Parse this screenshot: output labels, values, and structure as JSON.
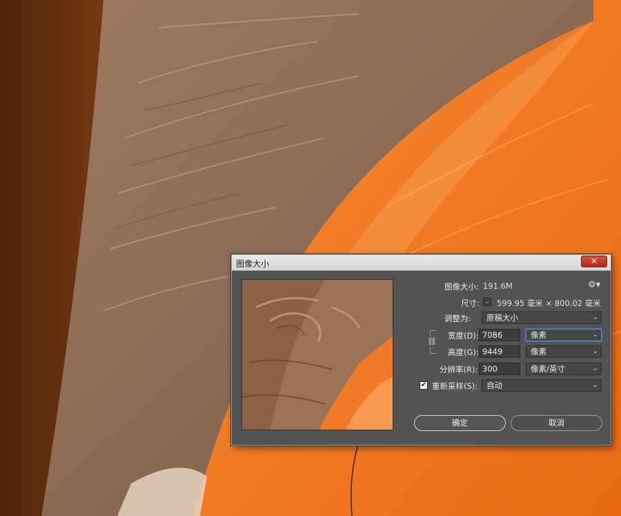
{
  "dialog": {
    "title": "图像大小",
    "close_label": "✕",
    "image_size_label": "图像大小:",
    "image_size_value": "191.6M",
    "gear_icon": "gear-icon",
    "dimensions_label": "尺寸:",
    "dimensions_value": "599.95 毫米  ×  800.02 毫米",
    "fit_to_label": "调整为:",
    "fit_to_value": "原稿大小",
    "width_label": "宽度(D):",
    "width_value": "7086",
    "width_unit": "像素",
    "height_label": "高度(G):",
    "height_value": "9449",
    "height_unit": "像素",
    "resolution_label": "分辨率(R):",
    "resolution_value": "300",
    "resolution_unit": "像素/英寸",
    "resample_label": "重新采样(S):",
    "resample_checked": true,
    "resample_value": "自动",
    "ok_label": "确定",
    "cancel_label": "取消",
    "chevron": "⌄"
  },
  "colors": {
    "dialog_bg": "#535353",
    "canvas_brown": "#8a6c56",
    "canvas_orange": "#f07420",
    "canvas_dark": "#5a2c10"
  }
}
